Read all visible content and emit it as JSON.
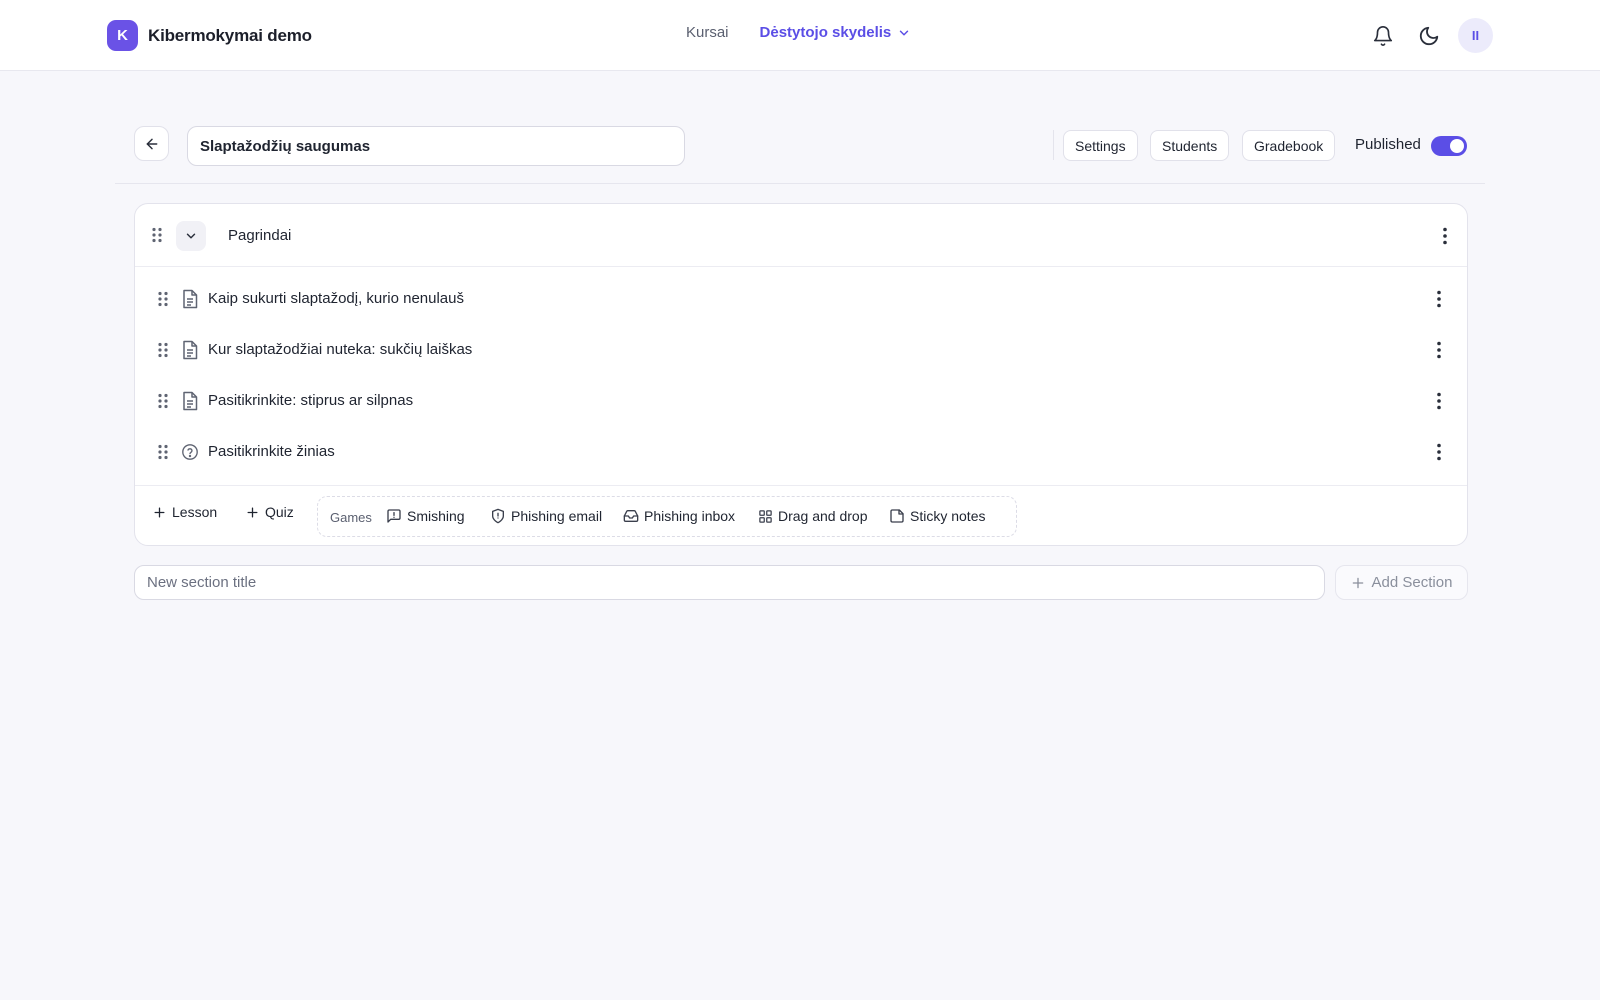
{
  "app": {
    "logo_letter": "K",
    "name": "Kibermokymai demo"
  },
  "nav": {
    "courses": "Kursai",
    "instructor_panel": "Dėstytojo skydelis"
  },
  "user": {
    "initials": "II"
  },
  "course": {
    "title": "Slaptažodžių saugumas",
    "buttons": {
      "settings": "Settings",
      "students": "Students",
      "gradebook": "Gradebook"
    },
    "published_label": "Published",
    "published": true
  },
  "section": {
    "title": "Pagrindai",
    "items": [
      {
        "type": "lesson",
        "icon": "document-icon",
        "title": "Kaip sukurti slaptažodį, kurio nenulauš"
      },
      {
        "type": "lesson",
        "icon": "document-icon",
        "title": "Kur slaptažodžiai nuteka: sukčių laiškas"
      },
      {
        "type": "lesson",
        "icon": "document-icon",
        "title": "Pasitikrinkite: stiprus ar silpnas"
      },
      {
        "type": "quiz",
        "icon": "question-circle-icon",
        "title": "Pasitikrinkite žinias"
      }
    ],
    "add": {
      "lesson": "Lesson",
      "quiz": "Quiz"
    },
    "games_label": "Games",
    "games": [
      {
        "icon": "message-alert-icon",
        "label": "Smishing"
      },
      {
        "icon": "shield-icon",
        "label": "Phishing email"
      },
      {
        "icon": "inbox-icon",
        "label": "Phishing inbox"
      },
      {
        "icon": "grid-icon",
        "label": "Drag and drop"
      },
      {
        "icon": "sticky-note-icon",
        "label": "Sticky notes"
      }
    ]
  },
  "new_section": {
    "placeholder": "New section title",
    "add_label": "Add Section"
  },
  "colors": {
    "accent": "#5b4ee6",
    "brand": "#6a52e6",
    "background": "#f7f7fb"
  }
}
